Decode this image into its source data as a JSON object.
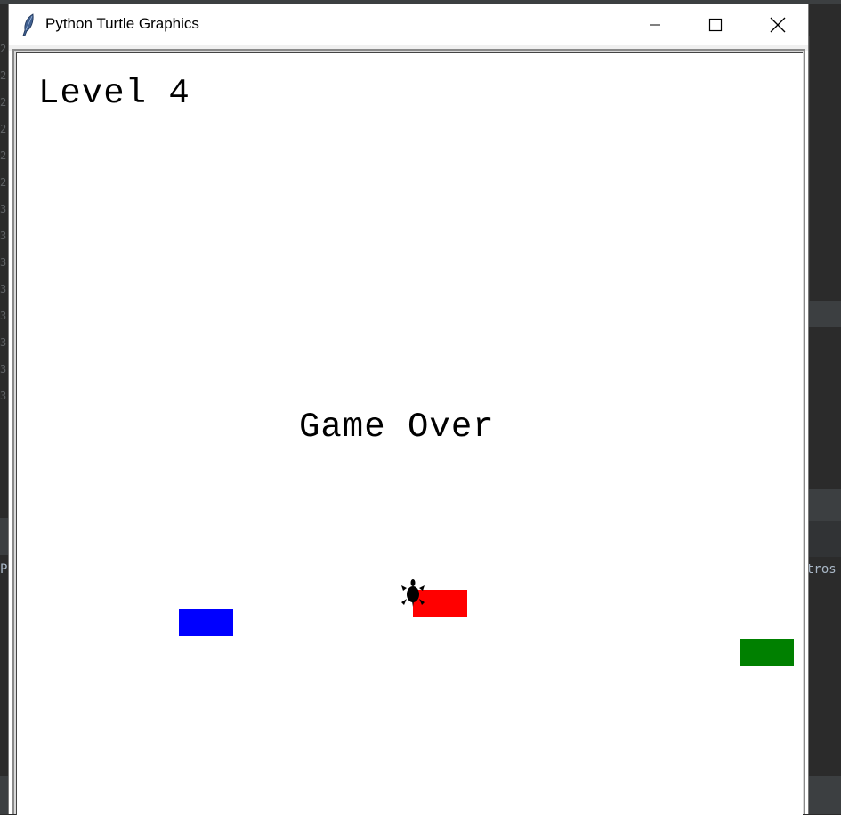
{
  "window": {
    "title": "Python Turtle Graphics",
    "controls": [
      "minimize",
      "maximize",
      "close"
    ]
  },
  "game": {
    "level_text": "Level 4",
    "status_text": "Game Over",
    "cars": [
      {
        "color": "#0000ff",
        "name": "blue"
      },
      {
        "color": "#ff0000",
        "name": "red"
      },
      {
        "color": "#008000",
        "name": "green"
      }
    ],
    "player": {
      "shape": "turtle",
      "color": "#000000",
      "heading": "up"
    }
  },
  "background_ide": {
    "gutter_digits": [
      "2",
      "2",
      "2",
      "2",
      "2",
      "2",
      "3",
      "3",
      "3",
      "3",
      "3",
      "3",
      "3",
      "3"
    ],
    "left_text": "Pr",
    "right_text": "tros"
  }
}
